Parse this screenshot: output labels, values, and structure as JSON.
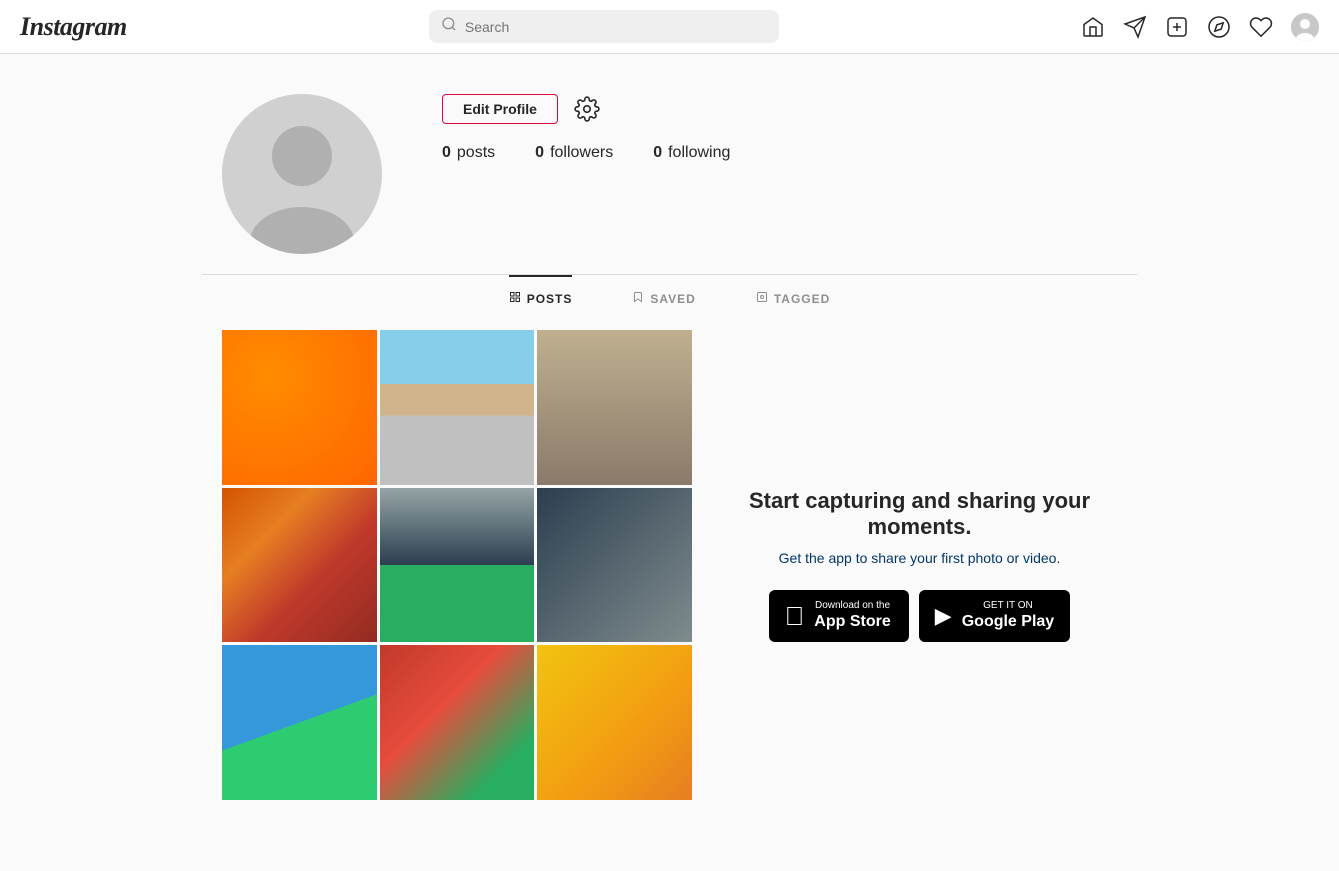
{
  "header": {
    "logo": "Instagram",
    "search": {
      "placeholder": "Search"
    },
    "nav": {
      "home": "home",
      "send": "send",
      "add": "add",
      "explore": "explore",
      "likes": "likes",
      "profile": "profile"
    }
  },
  "profile": {
    "edit_button": "Edit Profile",
    "stats": {
      "posts": {
        "count": "0",
        "label": "posts"
      },
      "followers": {
        "count": "0",
        "label": "followers"
      },
      "following": {
        "count": "0",
        "label": "following"
      }
    }
  },
  "tabs": [
    {
      "id": "posts",
      "label": "POSTS",
      "active": true
    },
    {
      "id": "saved",
      "label": "SAVED",
      "active": false
    },
    {
      "id": "tagged",
      "label": "TAGGED",
      "active": false
    }
  ],
  "promo": {
    "title": "Start capturing and sharing your moments.",
    "subtitle": "Get the app to share your first photo or video.",
    "appstore": {
      "small": "Download on the",
      "large": "App Store"
    },
    "googleplay": {
      "small": "GET IT ON",
      "large": "Google Play"
    }
  }
}
